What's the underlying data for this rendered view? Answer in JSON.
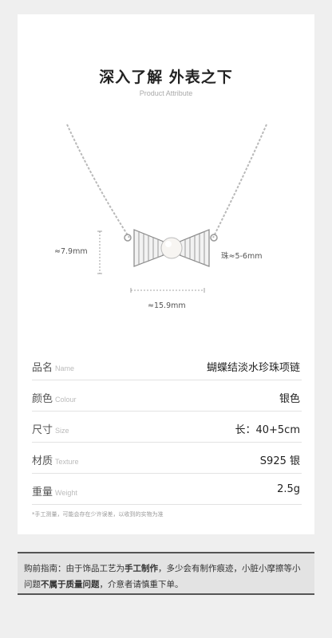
{
  "header": {
    "title": "深入了解 外表之下",
    "subtitle": "Product Attribute"
  },
  "dimensions": {
    "height": "≈7.9mm",
    "width": "≈15.9mm",
    "pearl": "珠≈5-6mm"
  },
  "specs": [
    {
      "label": "品名",
      "label_en": "Name",
      "value": "蝴蝶结淡水珍珠项链"
    },
    {
      "label": "颜色",
      "label_en": "Colour",
      "value": "银色"
    },
    {
      "label": "尺寸",
      "label_en": "Size",
      "value": "长：40+5cm"
    },
    {
      "label": "材质",
      "label_en": "Texture",
      "value": "S925 银"
    },
    {
      "label": "重量",
      "label_en": "Weight",
      "value": "2.5g"
    }
  ],
  "note": "*手工测量，可能会存在少许误差，以收到的实物为准",
  "notice": {
    "prefix": "购前指南：由于饰品工艺为",
    "bold1": "手工制作",
    "middle": "，多少会有制作痕迹，小脏小摩擦等小问题",
    "bold2": "不属于质量问题",
    "suffix": "，介意者请慎重下单。"
  },
  "colors": {
    "background": "#efefef",
    "card": "#ffffff",
    "notice_bg": "#e3e3e3"
  }
}
